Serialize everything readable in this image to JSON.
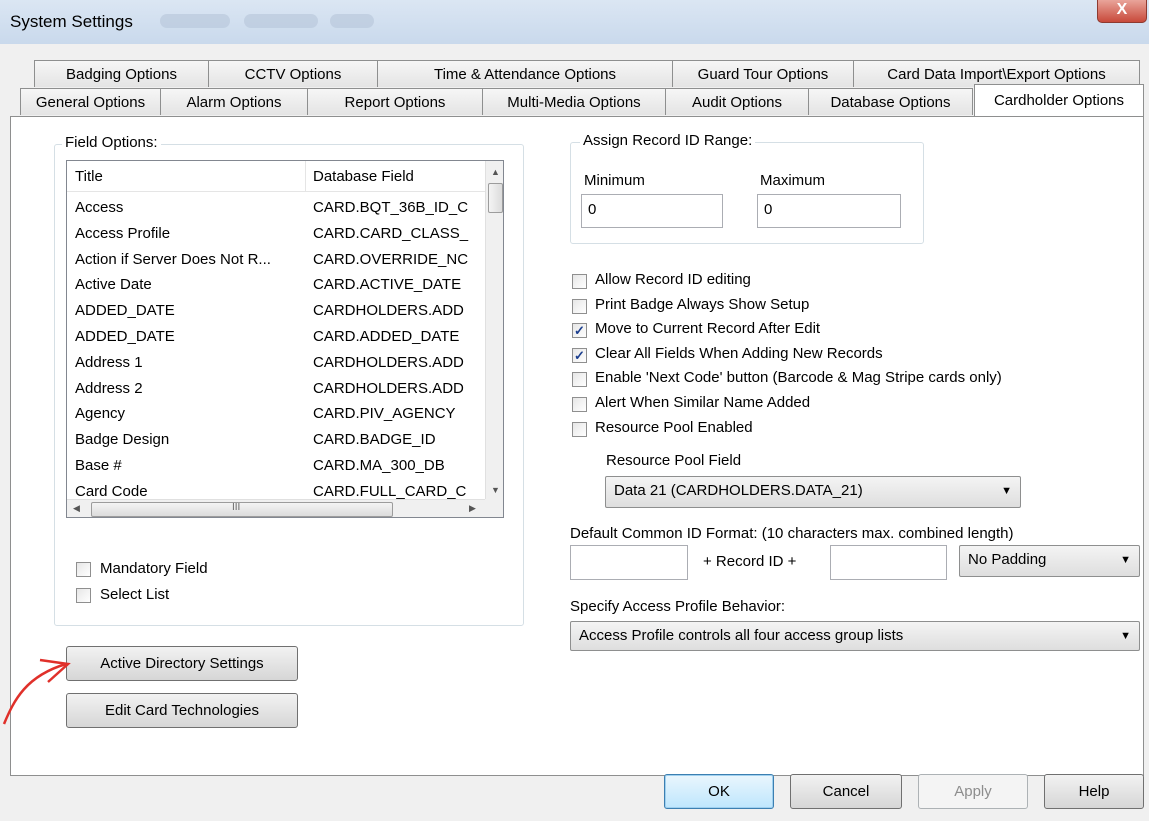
{
  "window": {
    "title": "System Settings",
    "close_glyph": "X"
  },
  "tabs_row1": [
    "Badging Options",
    "CCTV Options",
    "Time & Attendance Options",
    "Guard Tour Options",
    "Card Data Import\\Export Options"
  ],
  "tabs_row2": [
    "General Options",
    "Alarm Options",
    "Report Options",
    "Multi-Media Options",
    "Audit Options",
    "Database Options",
    "Cardholder Options"
  ],
  "field_options": {
    "label": "Field Options:",
    "columns": [
      "Title",
      "Database Field"
    ],
    "rows": [
      [
        "Access",
        "CARD.BQT_36B_ID_C"
      ],
      [
        "Access Profile",
        "CARD.CARD_CLASS_"
      ],
      [
        "Action if Server Does Not R...",
        "CARD.OVERRIDE_NC"
      ],
      [
        "Active Date",
        "CARD.ACTIVE_DATE"
      ],
      [
        "ADDED_DATE",
        "CARDHOLDERS.ADD"
      ],
      [
        "ADDED_DATE",
        "CARD.ADDED_DATE"
      ],
      [
        "Address 1",
        "CARDHOLDERS.ADD"
      ],
      [
        "Address 2",
        "CARDHOLDERS.ADD"
      ],
      [
        "Agency",
        "CARD.PIV_AGENCY"
      ],
      [
        "Badge Design",
        "CARD.BADGE_ID"
      ],
      [
        "Base #",
        "CARD.MA_300_DB"
      ],
      [
        "Card Code",
        "CARD.FULL_CARD_C"
      ]
    ],
    "hscroll_thumb_glyph": "III",
    "mandatory_label": "Mandatory Field",
    "select_list_label": "Select List"
  },
  "record_range": {
    "label": "Assign Record ID Range:",
    "min_label": "Minimum",
    "min_value": "0",
    "max_label": "Maximum",
    "max_value": "0"
  },
  "options": [
    {
      "label": "Allow Record ID editing",
      "checked": false
    },
    {
      "label": "Print Badge Always Show Setup",
      "checked": false
    },
    {
      "label": "Move to Current Record After Edit",
      "checked": true
    },
    {
      "label": "Clear All Fields When Adding New Records",
      "checked": true
    },
    {
      "label": "Enable 'Next Code' button (Barcode & Mag Stripe cards only)",
      "checked": false
    },
    {
      "label": "Alert When Similar Name Added",
      "checked": false
    },
    {
      "label": "Resource Pool Enabled",
      "checked": false
    }
  ],
  "resource_pool": {
    "label": "Resource Pool Field",
    "value": "Data 21 (CARDHOLDERS.DATA_21)"
  },
  "common_id": {
    "label": "Default Common ID Format: (10 characters max. combined length)",
    "prefix_value": "",
    "middle_text": "+ Record ID +",
    "suffix_value": "",
    "padding_value": "No Padding"
  },
  "access_profile": {
    "label": "Specify Access Profile Behavior:",
    "value": "Access Profile controls all four access group lists"
  },
  "buttons": {
    "active_directory": "Active Directory Settings",
    "edit_card_tech": "Edit Card Technologies",
    "ok": "OK",
    "cancel": "Cancel",
    "apply": "Apply",
    "help": "Help"
  },
  "colors": {
    "annotation_arrow": "#e0302a",
    "checkmark": "#1c3f8f"
  }
}
